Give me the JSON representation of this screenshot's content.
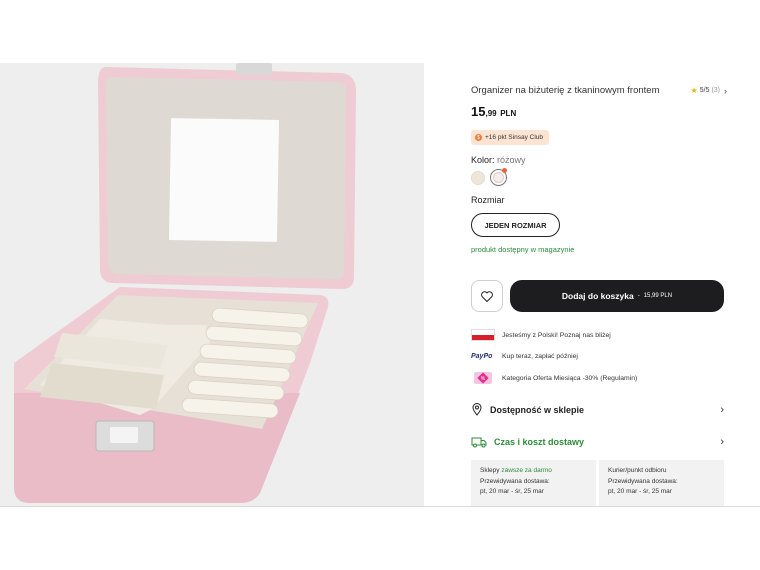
{
  "product": {
    "title": "Organizer na biżuterię z tkaninowym frontem",
    "rating": {
      "value": "5/5",
      "count": "(3)"
    },
    "price": {
      "whole": "15",
      "decimal": ",99",
      "currency": "PLN"
    },
    "club_badge": "+16 pkt Sinsay Club",
    "color": {
      "label": "Kolor:",
      "value": "różowy"
    },
    "size": {
      "label": "Rozmiar",
      "option": "JEDEN ROZMIAR"
    },
    "availability": "produkt dostępny w magazynie",
    "cart": {
      "label": "Dodaj do koszyka",
      "separator": "-",
      "amount": "15,99 PLN"
    }
  },
  "info_rows": [
    {
      "icon": "poland-flag-icon",
      "text": "Jesteśmy z Polski! Poznaj nas bliżej"
    },
    {
      "icon": "paypo-logo",
      "logo_text": "PayPo",
      "text": "Kup teraz, zapłać później"
    },
    {
      "icon": "discount-tag-icon",
      "text": "Kategoria Oferta Miesiąca -30% (Regulamin)"
    }
  ],
  "sections": {
    "store_availability": "Dostępność w sklepie",
    "delivery": "Czas i koszt dostawy"
  },
  "delivery_options": [
    {
      "name": "Sklepy",
      "note": "zawsze za darmo",
      "eta_label": "Przewidywana dostawa:",
      "eta": "pt, 20 mar - śr, 25 mar"
    },
    {
      "name": "Kurier/punkt odbioru",
      "note": "",
      "eta_label": "Przewidywana dostawa:",
      "eta": "pt, 20 mar - śr, 25 mar"
    }
  ],
  "colors": {
    "accent_dark": "#1d1d20",
    "success_green": "#2e8b3a",
    "badge_bg": "#fde3d2",
    "star": "#e9b20c"
  }
}
